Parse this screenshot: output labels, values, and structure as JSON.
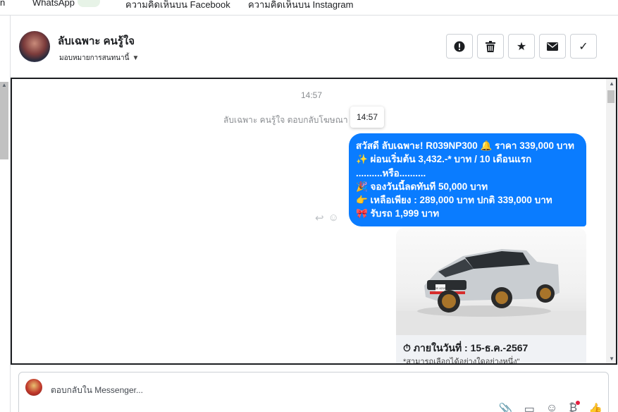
{
  "tabs": [
    {
      "label": "WhatsApp"
    },
    {
      "label": "ความคิดเห็นบน Facebook"
    },
    {
      "label": "ความคิดเห็นบน Instagram"
    }
  ],
  "header": {
    "contact_name": "ลับเฉพาะ คนรู้ใจ",
    "assign_label": "มอบหมายการสนทนานี้",
    "actions": [
      {
        "name": "report",
        "icon": "!"
      },
      {
        "name": "delete",
        "icon": "🗑"
      },
      {
        "name": "star",
        "icon": "★"
      },
      {
        "name": "mark-unread",
        "icon": "✉"
      },
      {
        "name": "done",
        "icon": "✓"
      }
    ]
  },
  "conversation": {
    "timestamp": "14:57",
    "reply_note": "ลับเฉพาะ คนรู้ใจ ตอบกลับโฆษณา",
    "tooltip_time": "14:57",
    "message_lines": [
      "สวัสดี ลับเฉพาะ!  R039NP300 🔔 ราคา 339,000 บาท",
      "✨ ผ่อนเริ่มต้น 3,432.-* บาท / 10 เดือนแรก",
      "..........หรือ..........",
      "🎉 จองวันนี้ลดทันที 50,000 บาท",
      "👉 เหลือเพียง : 289,000 บาท ปกติ 339,000 บาท",
      "🎀 รับรถ 1,999 บาท"
    ],
    "card": {
      "plate": "3ก 4210",
      "title": "⏱ ภายในวันที่ : 15-ธ.ค.-2567",
      "subtitle": "*สามารถเลือกได้อย่างใดอย่างหนึ่ง\""
    }
  },
  "composer": {
    "placeholder": "ตอบกลับใน Messenger..."
  },
  "colors": {
    "bubble": "#0a7cff",
    "border": "#1c1e21",
    "notification": "#e41e3f"
  }
}
